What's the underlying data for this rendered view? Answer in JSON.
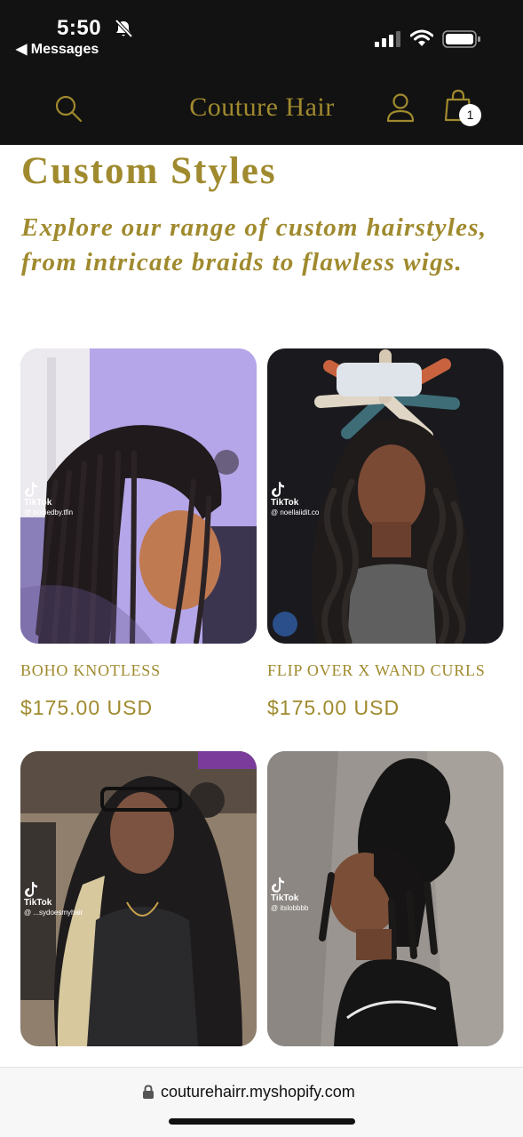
{
  "status_bar": {
    "time": "5:50",
    "back_label": "◀ Messages"
  },
  "header": {
    "brand": "Couture Hair",
    "cart_count": "1"
  },
  "page": {
    "title": "Custom Styles",
    "subtitle": "Explore our range of custom hairstyles, from intricate braids to flawless wigs."
  },
  "products": [
    {
      "name": "BOHO KNOTLESS",
      "price": "$175.00 USD",
      "tiktok_label": "TikTok",
      "tiktok_user": "@ bodiedby.tfin"
    },
    {
      "name": "FLIP OVER X WAND CURLS",
      "price": "$175.00 USD",
      "tiktok_label": "TikTok",
      "tiktok_user": "@ noellaiidit.co"
    },
    {
      "tiktok_label": "TikTok",
      "tiktok_user": "@ ...sydoesmyhair"
    },
    {
      "tiktok_label": "TikTok",
      "tiktok_user": "@ itslobbbb"
    }
  ],
  "browser": {
    "url": "couturehairr.myshopify.com"
  },
  "colors": {
    "accent": "#a08a2e",
    "header_bg": "#121212"
  },
  "icons": [
    "bell-slash-icon",
    "signal-icon",
    "wifi-icon",
    "battery-icon",
    "search-icon",
    "account-icon",
    "cart-icon",
    "lock-icon",
    "tiktok-icon"
  ]
}
